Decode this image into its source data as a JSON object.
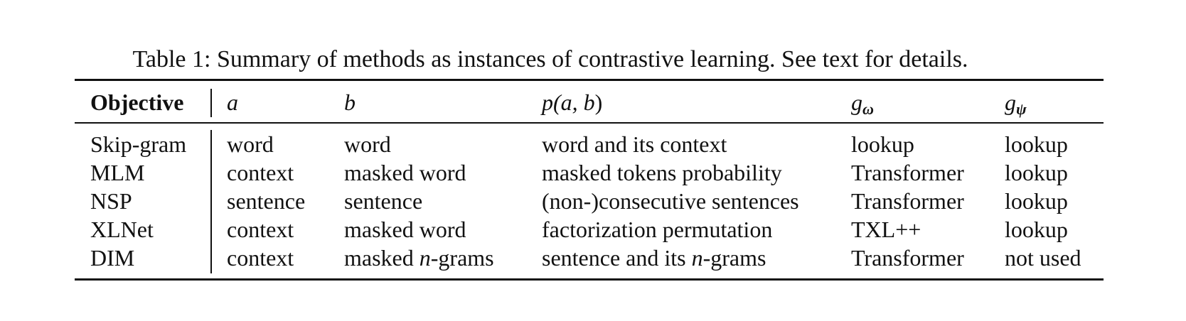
{
  "caption": "Table 1: Summary of methods as instances of contrastive learning. See text for details.",
  "table": {
    "headers": {
      "objective": "Objective",
      "a": "a",
      "b": "b",
      "p_open": "p(",
      "p_args": "a, b",
      "p_close": ")",
      "g_omega_base": "g",
      "g_omega_sub": "ω",
      "g_psi_base": "g",
      "g_psi_sub": "ψ"
    },
    "rows": [
      {
        "objective": "Skip-gram",
        "a": "word",
        "b": "word",
        "p": "word and its context",
        "g_omega": "lookup",
        "g_psi": "lookup"
      },
      {
        "objective": "MLM",
        "a": "context",
        "b": "masked word",
        "p": "masked tokens probability",
        "g_omega": "Transformer",
        "g_psi": "lookup"
      },
      {
        "objective": "NSP",
        "a": "sentence",
        "b": "sentence",
        "p": "(non-)consecutive sentences",
        "g_omega": "Transformer",
        "g_psi": "lookup"
      },
      {
        "objective": "XLNet",
        "a": "context",
        "b": "masked word",
        "p": "factorization permutation",
        "g_omega": "TXL++",
        "g_psi": "lookup"
      },
      {
        "objective": "DIM",
        "a": "context",
        "b_pre": "masked ",
        "b_var": "n",
        "b_post": "-grams",
        "p_pre": "sentence and its ",
        "p_var": "n",
        "p_post": "-grams",
        "g_omega": "Transformer",
        "g_psi": "not used"
      }
    ]
  }
}
